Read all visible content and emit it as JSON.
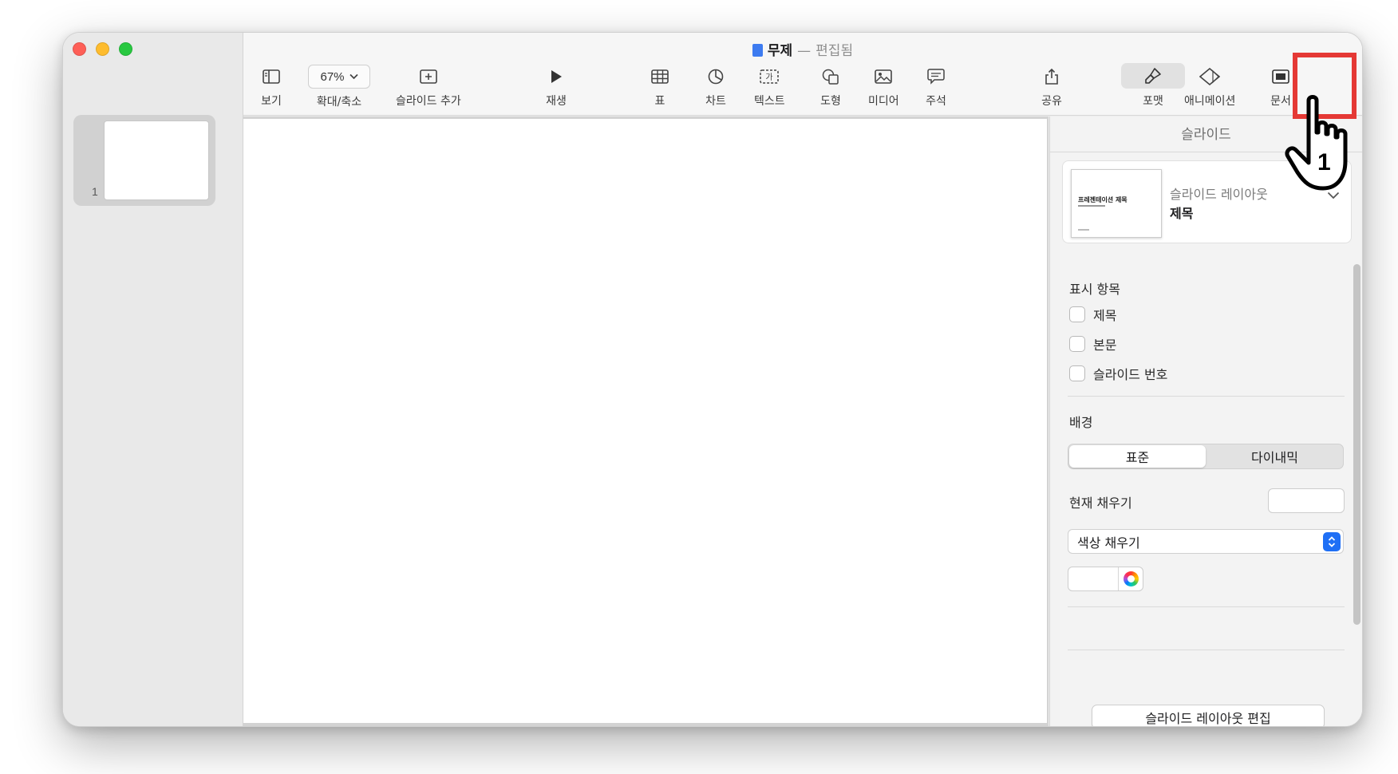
{
  "window": {
    "title": "무제",
    "title_separator": "—",
    "title_state": "편집됨"
  },
  "sidebar": {
    "slides": [
      {
        "number": "1"
      }
    ]
  },
  "toolbar": {
    "view": "보기",
    "zoom_value": "67%",
    "zoom": "확대/축소",
    "add_slide": "슬라이드 추가",
    "play": "재생",
    "table": "표",
    "chart": "차트",
    "text": "텍스트",
    "shape": "도형",
    "media": "미디어",
    "comment": "주석",
    "share": "공유",
    "format": "포맷",
    "animate": "애니메이션",
    "document": "문서"
  },
  "inspector": {
    "header": "슬라이드",
    "layout": {
      "thumb_title": "프레젠테이션 제목",
      "caption": "슬라이드 레이아웃",
      "name": "제목"
    },
    "appearance": {
      "label": "표시 항목",
      "items": [
        "제목",
        "본문",
        "슬라이드 번호"
      ]
    },
    "background": {
      "label": "배경",
      "segments": [
        "표준",
        "다이내믹"
      ],
      "selected": "표준",
      "current_fill_label": "현재 채우기",
      "fill_type": "색상 채우기"
    },
    "edit_layout_button": "슬라이드 레이아웃 편집"
  },
  "overlay": {
    "step_number": "1"
  },
  "colors": {
    "accent": "#1f6ff5",
    "highlight": "#e53935"
  }
}
